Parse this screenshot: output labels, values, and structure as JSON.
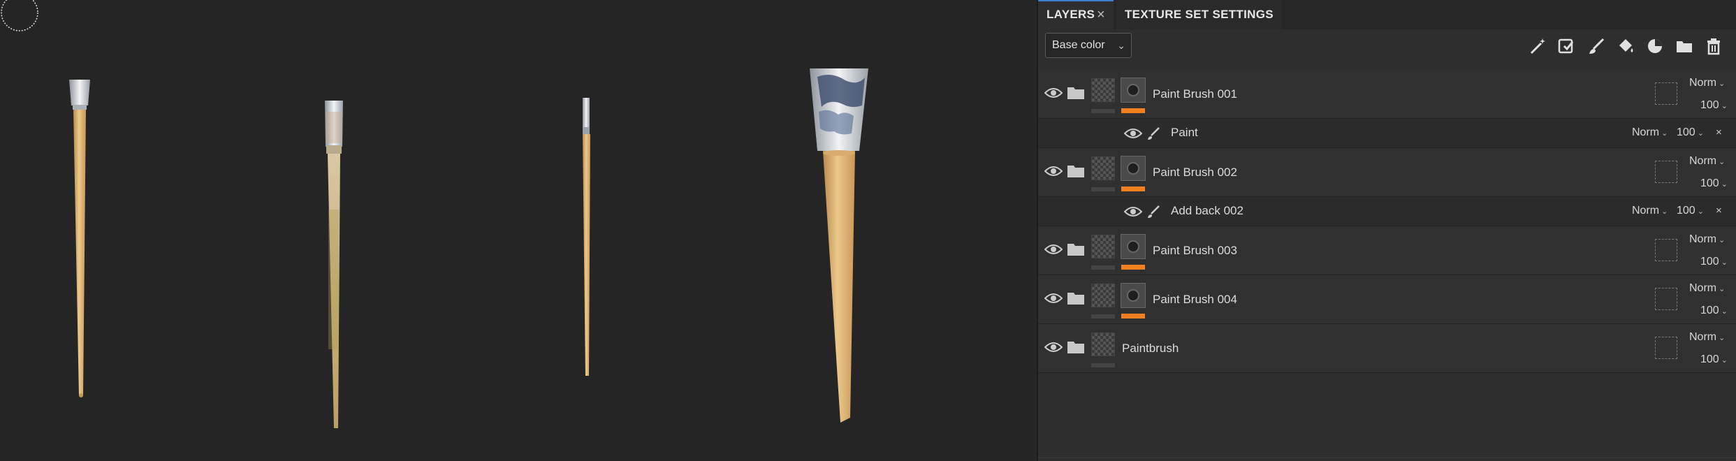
{
  "tabs": {
    "layers": "LAYERS",
    "texture_set_settings": "TEXTURE SET SETTINGS"
  },
  "channel_select": {
    "value": "Base color"
  },
  "toolbar_icons": [
    "magic-wand-icon",
    "add-mask-icon",
    "paint-brush-icon",
    "fill-bucket-icon",
    "color-selection-icon",
    "folder-icon",
    "trash-icon"
  ],
  "layers": [
    {
      "name": "Paint Brush 001",
      "blend": "Norm",
      "opacity": "100",
      "has_mask": true
    },
    {
      "name": "Paint",
      "blend": "Norm",
      "opacity": "100",
      "sublayer": true
    },
    {
      "name": "Paint Brush 002",
      "blend": "Norm",
      "opacity": "100",
      "has_mask": true
    },
    {
      "name": "Add back 002",
      "blend": "Norm",
      "opacity": "100",
      "sublayer": true
    },
    {
      "name": "Paint Brush 003",
      "blend": "Norm",
      "opacity": "100",
      "has_mask": true
    },
    {
      "name": "Paint Brush 004",
      "blend": "Norm",
      "opacity": "100",
      "has_mask": true
    },
    {
      "name": "Paintbrush",
      "blend": "Norm",
      "opacity": "100",
      "has_mask": false
    }
  ],
  "colors": {
    "accent": "#3d7fcf",
    "mask_color": "#f08020",
    "wood": "#e2b774",
    "metal": "#c8ccd2"
  }
}
